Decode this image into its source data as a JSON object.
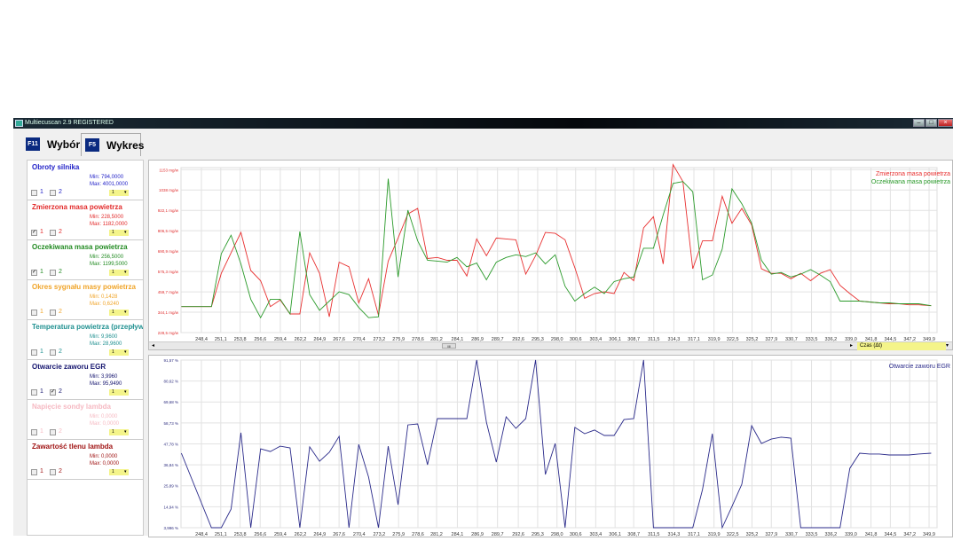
{
  "window": {
    "title": "Multiecuscan 2.9 REGISTERED",
    "min": "–",
    "max": "□",
    "close": "×"
  },
  "tabs": [
    {
      "key": "F11",
      "label": "Wybór"
    },
    {
      "key": "F5",
      "label": "Wykres"
    }
  ],
  "params": [
    {
      "name": "Obroty silnika",
      "min": "Min: 794,0000",
      "max": "Max: 4001,0000",
      "color": "#2323c8",
      "c1": false,
      "c2": false,
      "sel": "1"
    },
    {
      "name": "Zmierzona masa powietrza",
      "min": "Min: 228,5000",
      "max": "Max: 1182,0000",
      "color": "#e22a2a",
      "c1": true,
      "c2": false,
      "sel": "1"
    },
    {
      "name": "Oczekiwana masa powietrza",
      "min": "Min: 256,5000",
      "max": "Max: 1199,5000",
      "color": "#218a21",
      "c1": true,
      "c2": false,
      "sel": "1"
    },
    {
      "name": "Okres sygnału masy powietrza",
      "min": "Min: 0,1428",
      "max": "Max: 0,6240",
      "color": "#f0a428",
      "c1": false,
      "c2": false,
      "sel": "1"
    },
    {
      "name": "Temperatura powietrza (przepływ",
      "min": "Min: 9,9600",
      "max": "Max: 28,9600",
      "color": "#1f9090",
      "c1": false,
      "c2": false,
      "sel": "1"
    },
    {
      "name": "Otwarcie zaworu EGR",
      "min": "Min: 3,9960",
      "max": "Max: 95,9490",
      "color": "#14146e",
      "c1": false,
      "c2": true,
      "sel": "1"
    },
    {
      "name": "Napięcie sondy lambda",
      "min": "Min: 0,0000",
      "max": "Max: 0,0000",
      "color": "#f6b9c2",
      "c1": false,
      "c2": false,
      "sel": "1"
    },
    {
      "name": "Zawartość tlenu lambda",
      "min": "Min: 0,0000",
      "max": "Max: 0,0000",
      "color": "#a01414",
      "c1": false,
      "c2": false,
      "sel": "1"
    }
  ],
  "cb_labels": [
    "1",
    "2"
  ],
  "scroll": {
    "thumb": "III",
    "left": "◂",
    "right": "▸",
    "axis_select": "Czas (Δt)",
    "arrow": "▾"
  },
  "chart_data": [
    {
      "type": "line",
      "xlabel": "Czas (Δt)",
      "legend": "top-right",
      "x_first": 245.6,
      "x_uniform_start": 249.8,
      "x_step": 1.37,
      "x_last": 350.2,
      "xlim": [
        245.6,
        350.2
      ],
      "ylim": [
        228.5,
        1164.8
      ],
      "x_ticks": [
        "248,4",
        "251,1",
        "253,8",
        "256,6",
        "259,4",
        "262,2",
        "264,9",
        "267,6",
        "270,4",
        "273,2",
        "275,9",
        "278,6",
        "281,2",
        "284,1",
        "286,9",
        "289,7",
        "292,6",
        "295,3",
        "298,0",
        "300,6",
        "303,4",
        "306,1",
        "308,7",
        "311,5",
        "314,3",
        "317,1",
        "319,9",
        "322,5",
        "325,2",
        "327,9",
        "330,7",
        "333,5",
        "336,2",
        "339,0",
        "341,8",
        "344,5",
        "347,2",
        "349,9"
      ],
      "y_ticks": [
        {
          "v": 228.5,
          "label": "228,5 mg/w"
        },
        {
          "v": 344.1,
          "label": "344,1 mg/w"
        },
        {
          "v": 459.7,
          "label": "459,7 mg/w"
        },
        {
          "v": 575.3,
          "label": "575,3 mg/w"
        },
        {
          "v": 690.9,
          "label": "690,9 mg/w"
        },
        {
          "v": 806.5,
          "label": "806,5 mg/w"
        },
        {
          "v": 922.1,
          "label": "922,1 mg/w"
        },
        {
          "v": 1037.7,
          "label": "1038 mg/w"
        },
        {
          "v": 1153.3,
          "label": "1153 mg/w"
        }
      ],
      "series": [
        {
          "name": "Zmierzona masa powietrza",
          "color": "#e83030",
          "values": [
            376,
            376,
            565,
            681,
            797,
            581,
            523,
            376,
            413,
            334,
            334,
            681,
            565,
            318,
            628,
            602,
            397,
            534,
            328,
            634,
            765,
            902,
            933,
            649,
            655,
            639,
            639,
            549,
            760,
            665,
            765,
            760,
            755,
            560,
            665,
            797,
            792,
            755,
            597,
            423,
            450,
            460,
            450,
            570,
            523,
            823,
            886,
            618,
            1182,
            1086,
            591,
            749,
            749,
            1002,
            849,
            933,
            839,
            591,
            565,
            565,
            534,
            565,
            523,
            565,
            586,
            497,
            450,
            407,
            402,
            397,
            392,
            392,
            386,
            386,
            381
          ]
        },
        {
          "name": "Oczekiwana masa powietrza",
          "color": "#2a9a2a",
          "values": [
            376,
            376,
            676,
            781,
            618,
            418,
            313,
            418,
            418,
            334,
            802,
            444,
            355,
            407,
            460,
            444,
            371,
            313,
            318,
            1102,
            544,
            923,
            749,
            639,
            634,
            628,
            655,
            602,
            623,
            528,
            628,
            655,
            670,
            660,
            681,
            618,
            670,
            492,
            407,
            450,
            486,
            450,
            518,
            534,
            544,
            707,
            707,
            897,
            1075,
            1086,
            1028,
            528,
            555,
            702,
            1044,
            960,
            849,
            639,
            560,
            570,
            544,
            560,
            586,
            555,
            518,
            407,
            407,
            407,
            402,
            397,
            397,
            392,
            392,
            392,
            381
          ]
        }
      ]
    },
    {
      "type": "line",
      "legend": "top-right",
      "x_first": 245.6,
      "x_uniform_start": 249.8,
      "x_step": 1.37,
      "x_last": 350.2,
      "xlim": [
        245.6,
        350.2
      ],
      "ylim": [
        3.996,
        91.57
      ],
      "y_ticks": [
        {
          "v": 3.996,
          "label": "3,996 %"
        },
        {
          "v": 14.94,
          "label": "14,94 %"
        },
        {
          "v": 25.89,
          "label": "25,89 %"
        },
        {
          "v": 36.84,
          "label": "36,84 %"
        },
        {
          "v": 47.78,
          "label": "47,78 %"
        },
        {
          "v": 58.73,
          "label": "58,73 %"
        },
        {
          "v": 69.68,
          "label": "69,68 %"
        },
        {
          "v": 80.62,
          "label": "80,62 %"
        },
        {
          "v": 91.57,
          "label": "91,57 %"
        }
      ],
      "series": [
        {
          "name": "Otwarcie zaworu EGR",
          "color": "#2a2a8a",
          "values": [
            42.9,
            4.0,
            4.0,
            13.7,
            53.6,
            4.0,
            45.2,
            43.8,
            46.6,
            45.7,
            4.0,
            46.2,
            38.7,
            43.4,
            51.7,
            4.0,
            47.5,
            30.4,
            4.0,
            46.6,
            16.0,
            57.7,
            58.2,
            36.9,
            61.0,
            61.0,
            61.0,
            61.0,
            91.6,
            59.1,
            38.3,
            61.9,
            55.9,
            61.0,
            91.6,
            31.8,
            48.0,
            4.0,
            56.4,
            53.1,
            55.0,
            52.2,
            52.2,
            60.5,
            61.0,
            91.6,
            4.0,
            4.0,
            4.0,
            4.0,
            4.0,
            23.9,
            53.1,
            4.0,
            15.1,
            26.7,
            57.3,
            48.0,
            50.3,
            51.3,
            50.8,
            4.0,
            4.0,
            4.0,
            4.0,
            4.0,
            35.0,
            42.9,
            42.5,
            42.5,
            42.0,
            42.0,
            42.0,
            42.5,
            42.9
          ]
        }
      ]
    }
  ]
}
